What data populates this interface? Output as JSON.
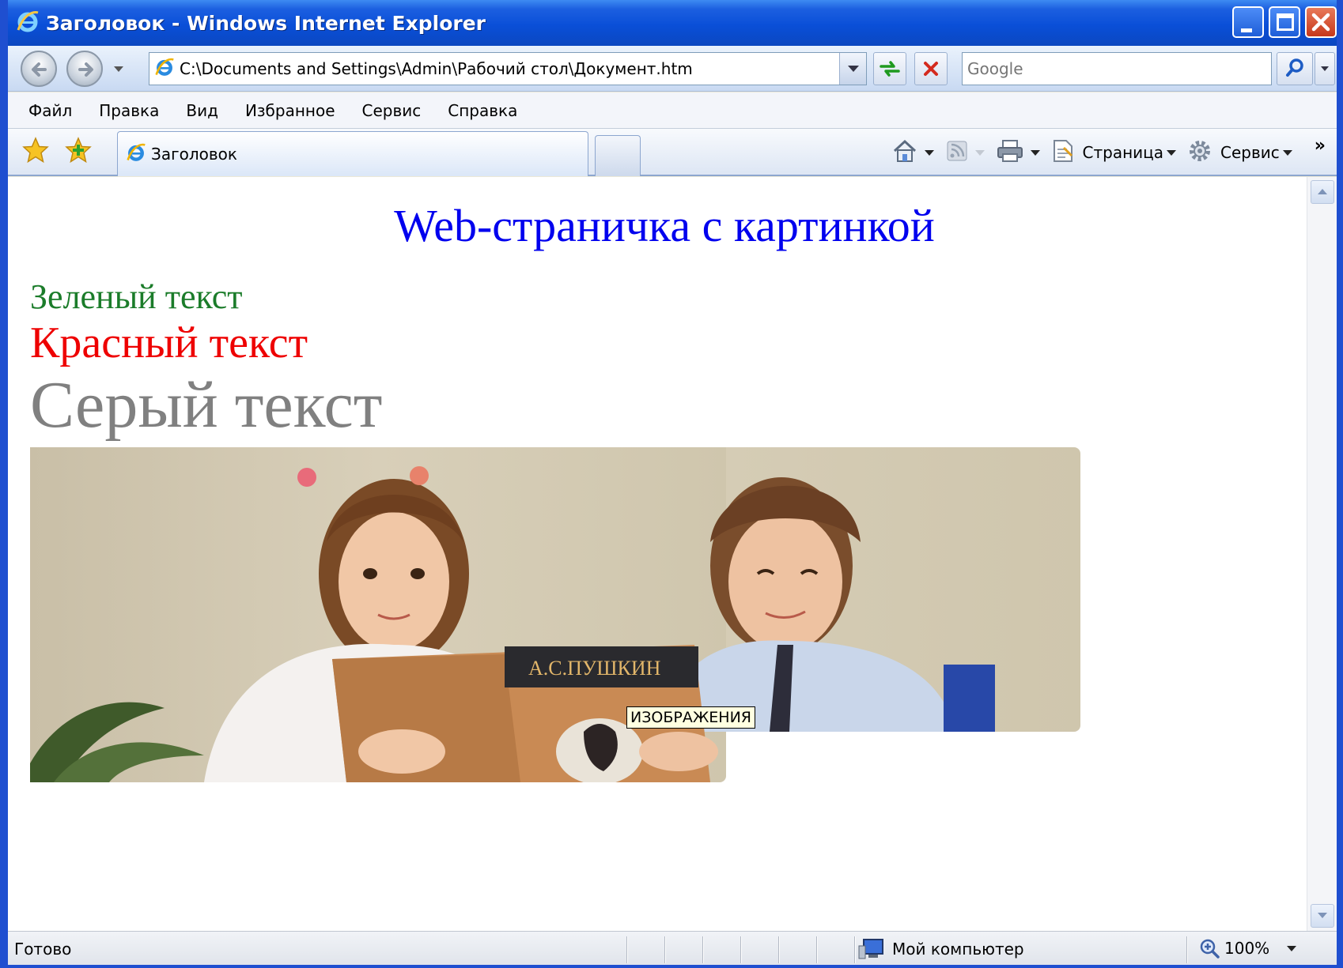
{
  "window": {
    "title": "Заголовок - Windows Internet Explorer"
  },
  "address_bar": {
    "url": "C:\\Documents and Settings\\Admin\\Рабочий стол\\Документ.htm",
    "search_placeholder": "Google"
  },
  "menu": {
    "items": [
      "Файл",
      "Правка",
      "Вид",
      "Избранное",
      "Сервис",
      "Справка"
    ]
  },
  "tabs": {
    "active_label": "Заголовок"
  },
  "command_bar": {
    "page_label": "Страница",
    "tools_label": "Сервис",
    "more": "»"
  },
  "page": {
    "heading": "Web-страничка с картинкой",
    "green_text": "Зеленый текст",
    "red_text": "Красный текст",
    "gray_text": "Серый текст",
    "image_tooltip": "ИЗОБРАЖЕНИЯ",
    "colors": {
      "heading": "#0000ee",
      "green": "#1b7c2a",
      "red": "#ee0000",
      "gray": "#808080"
    }
  },
  "status_bar": {
    "status": "Готово",
    "zone": "Мой компьютер",
    "zoom": "100%"
  },
  "icons": [
    "ie-icon",
    "back-icon",
    "forward-icon",
    "refresh-icon",
    "stop-icon",
    "search-icon",
    "favorites-star-icon",
    "add-favorites-icon",
    "home-icon",
    "feeds-icon",
    "print-icon",
    "page-icon",
    "gear-icon",
    "computer-icon",
    "zoom-icon"
  ]
}
